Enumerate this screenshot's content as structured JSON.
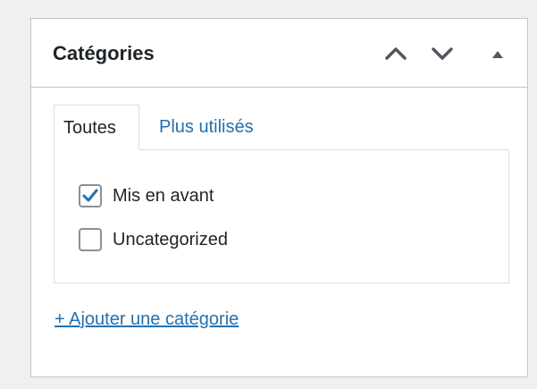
{
  "metabox": {
    "title": "Catégories",
    "controls": {
      "move_up_icon": "chevron-up-icon",
      "move_down_icon": "chevron-down-icon",
      "toggle_icon": "triangle-up-icon"
    }
  },
  "tabs": [
    {
      "label": "Toutes",
      "active": true
    },
    {
      "label": "Plus utilisés",
      "active": false
    }
  ],
  "categories": [
    {
      "label": "Mis en avant",
      "checked": true
    },
    {
      "label": "Uncategorized",
      "checked": false
    }
  ],
  "add_link": {
    "label": "+ Ajouter une catégorie"
  },
  "colors": {
    "background": "#f0f0f1",
    "panel": "#ffffff",
    "border": "#c3c4c7",
    "link": "#2271b1",
    "text": "#1d2327",
    "check": "#2271b1"
  }
}
